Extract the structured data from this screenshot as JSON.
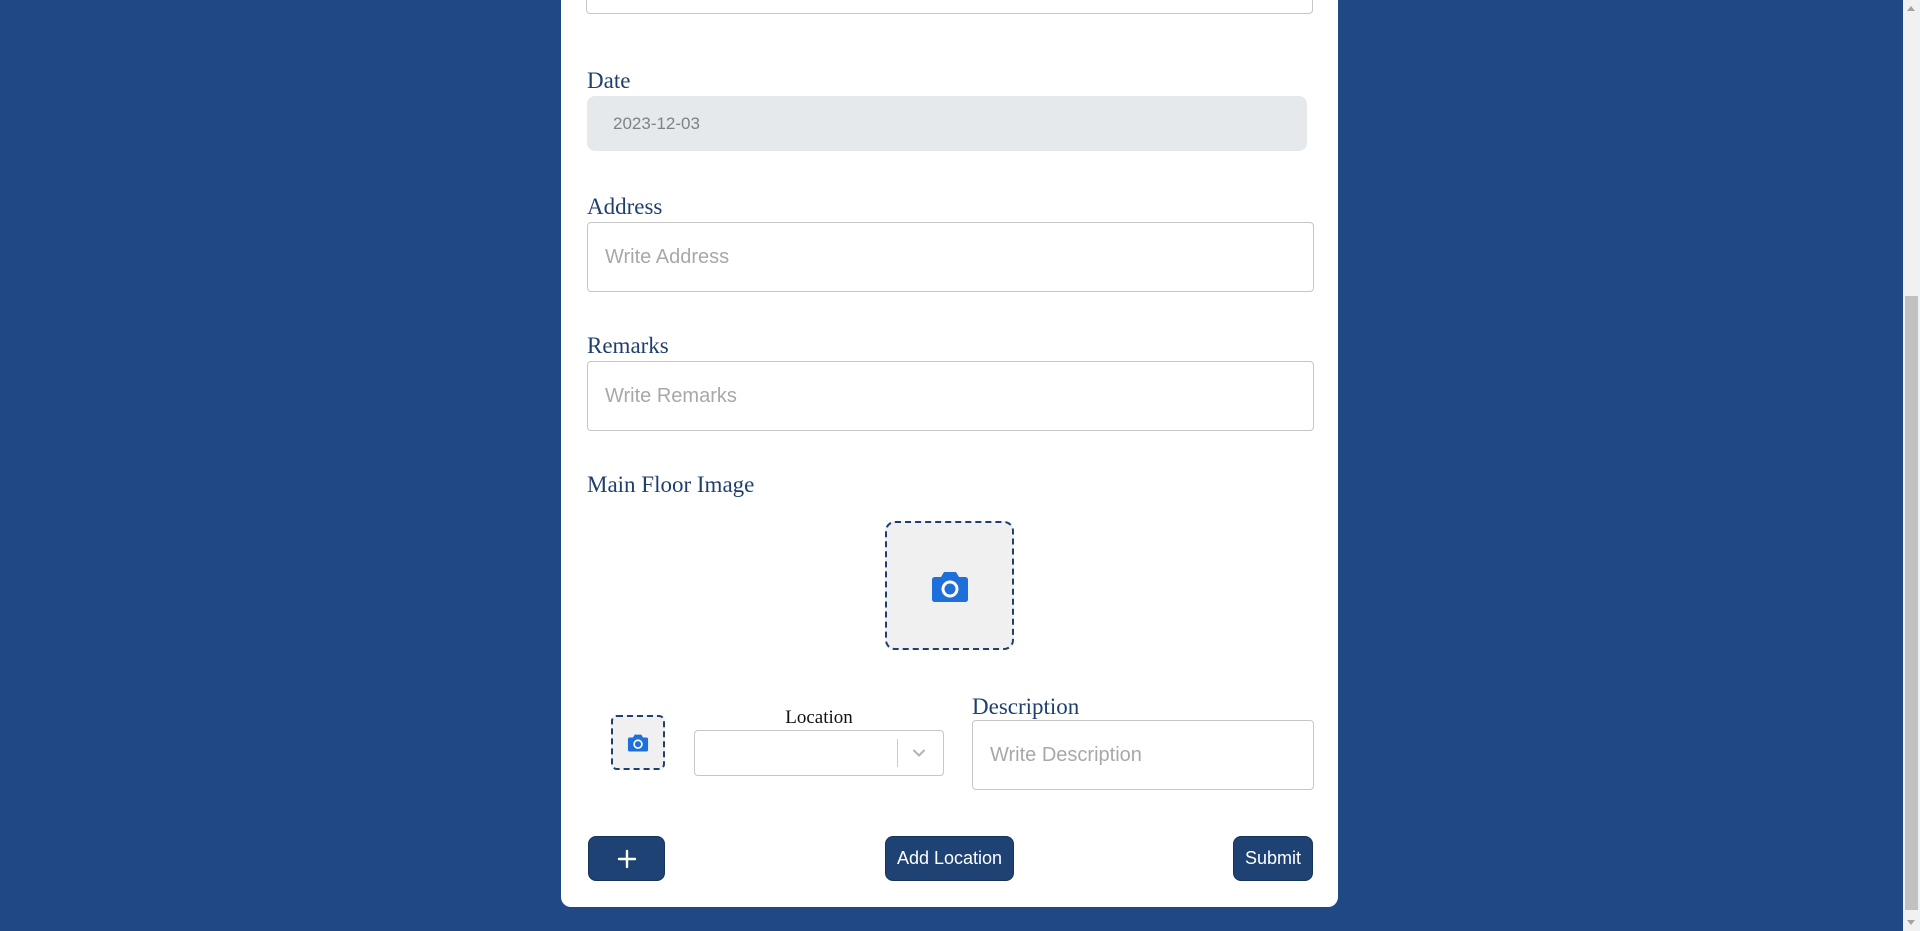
{
  "form": {
    "date": {
      "label": "Date",
      "value": "2023-12-03"
    },
    "address": {
      "label": "Address",
      "placeholder": "Write Address",
      "value": ""
    },
    "remarks": {
      "label": "Remarks",
      "placeholder": "Write Remarks",
      "value": ""
    },
    "main_floor_image": {
      "label": "Main Floor Image",
      "icon": "camera-icon"
    },
    "location_row": {
      "image_icon": "camera-icon",
      "location_label": "Location",
      "location_selected": "",
      "description_label": "Description",
      "description_placeholder": "Write Description"
    },
    "buttons": {
      "add_row_label": "+",
      "add_location_label": "Add Location",
      "submit_label": "Submit"
    }
  },
  "colors": {
    "page_background": "#1f4885",
    "button_background": "#1e4273",
    "label_color": "#1f3f6e",
    "camera_icon": "#1e6fd9"
  }
}
